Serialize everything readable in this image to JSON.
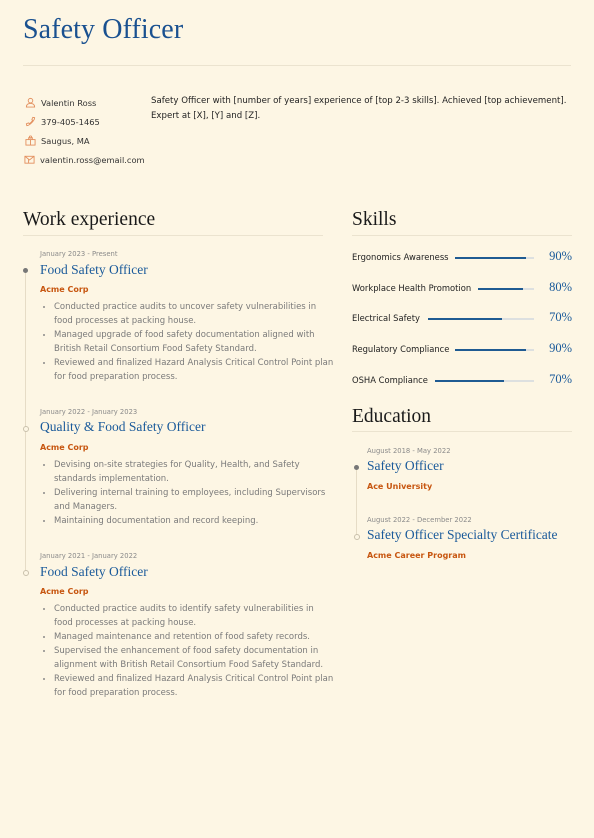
{
  "header": {
    "title": "Safety Officer"
  },
  "contact": [
    {
      "icon": "person-icon",
      "text": "Valentin Ross"
    },
    {
      "icon": "phone-icon",
      "text": "379-405-1465"
    },
    {
      "icon": "location-icon",
      "text": "Saugus, MA"
    },
    {
      "icon": "email-icon",
      "text": "valentin.ross@email.com"
    }
  ],
  "summary": "Safety Officer with [number of years] experience of [top 2-3 skills]. Achieved [top achievement]. Expert at [X], [Y] and [Z].",
  "work": {
    "title": "Work experience",
    "items": [
      {
        "date": "January 2023 - Present",
        "role": "Food Safety Officer",
        "company": "Acme Corp",
        "bullets": [
          "Conducted practice audits to uncover safety vulnerabilities in food processes at packing house.",
          "Managed upgrade of food safety documentation aligned with British Retail Consortium Food Safety Standard.",
          "Reviewed and finalized Hazard Analysis Critical Control Point plan for food preparation process."
        ]
      },
      {
        "date": "January 2022 - January 2023",
        "role": "Quality & Food Safety Officer",
        "company": "Acme Corp",
        "bullets": [
          "Devising on-site strategies for Quality, Health, and Safety standards implementation.",
          "Delivering internal training to employees, including Supervisors and Managers.",
          "Maintaining documentation and record keeping."
        ]
      },
      {
        "date": "January 2021 - January 2022",
        "role": "Food Safety Officer",
        "company": "Acme Corp",
        "bullets": [
          "Conducted practice audits to identify safety vulnerabilities in food processes at packing house.",
          "Managed maintenance and retention of food safety records.",
          "Supervised the enhancement of food safety documentation in alignment with British Retail Consortium Food Safety Standard.",
          "Reviewed and finalized Hazard Analysis Critical Control Point plan for food preparation process."
        ]
      }
    ]
  },
  "skills": {
    "title": "Skills",
    "items": [
      {
        "name": "Ergonomics Awareness",
        "level": 90,
        "label": "90%"
      },
      {
        "name": "Workplace Health Promotion",
        "level": 80,
        "label": "80%"
      },
      {
        "name": "Electrical Safety",
        "level": 70,
        "label": "70%"
      },
      {
        "name": "Regulatory Compliance",
        "level": 90,
        "label": "90%"
      },
      {
        "name": "OSHA Compliance",
        "level": 70,
        "label": "70%"
      }
    ]
  },
  "education": {
    "title": "Education",
    "items": [
      {
        "date": "August 2018 - May 2022",
        "degree": "Safety Officer",
        "school": "Ace University"
      },
      {
        "date": "August 2022 - December 2022",
        "degree": "Safety Officer Specialty Certificate",
        "school": "Acme Career Program"
      }
    ]
  },
  "colors": {
    "accent_blue": "#1a5a9a",
    "accent_orange": "#c75610",
    "icon_orange": "#e39160",
    "background": "#fdf6e4"
  }
}
